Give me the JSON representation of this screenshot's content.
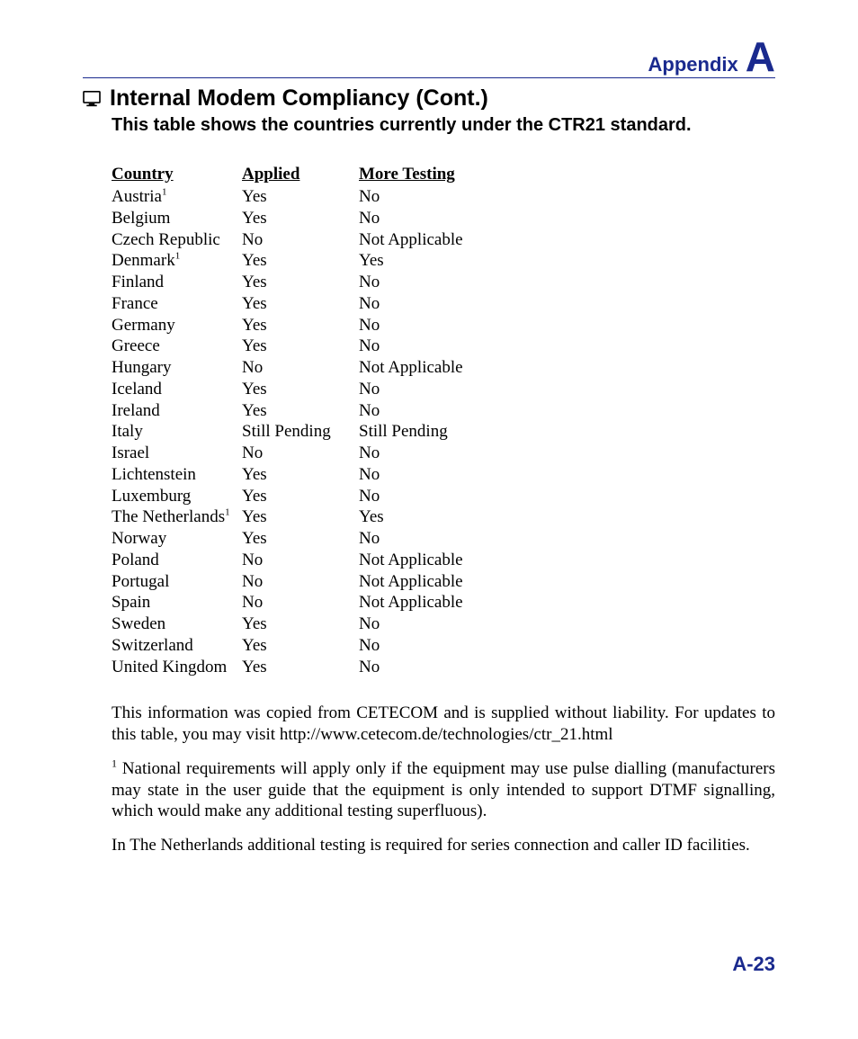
{
  "header": {
    "appendix_label": "Appendix",
    "appendix_letter": "A"
  },
  "title": "Internal Modem Compliancy (Cont.)",
  "subtitle": "This table shows the countries currently under the CTR21 standard.",
  "table": {
    "headers": {
      "country": "Country",
      "applied": "Applied",
      "more": "More Testing"
    },
    "rows": [
      {
        "country": "Austria",
        "sup": "1",
        "applied": "Yes",
        "more": "No"
      },
      {
        "country": "Belgium",
        "applied": "Yes",
        "more": "No"
      },
      {
        "country": "Czech Republic",
        "applied": "No",
        "more": "Not Applicable"
      },
      {
        "country": "Denmark",
        "sup": "1",
        "applied": "Yes",
        "more": "Yes"
      },
      {
        "country": "Finland",
        "applied": "Yes",
        "more": "No"
      },
      {
        "country": "France",
        "applied": "Yes",
        "more": "No"
      },
      {
        "country": "Germany",
        "applied": "Yes",
        "more": "No"
      },
      {
        "country": "Greece",
        "applied": "Yes",
        "more": "No"
      },
      {
        "country": "Hungary",
        "applied": "No",
        "more": "Not Applicable"
      },
      {
        "country": "Iceland",
        "applied": "Yes",
        "more": "No"
      },
      {
        "country": "Ireland",
        "applied": "Yes",
        "more": "No"
      },
      {
        "country": "Italy",
        "applied": "Still Pending",
        "more": "Still Pending"
      },
      {
        "country": "Israel",
        "applied": "No",
        "more": "No"
      },
      {
        "country": "Lichtenstein",
        "applied": "Yes",
        "more": "No"
      },
      {
        "country": "Luxemburg",
        "applied": "Yes",
        "more": "No"
      },
      {
        "country": "The Netherlands",
        "sup": "1",
        "applied": "Yes",
        "more": "Yes"
      },
      {
        "country": "Norway",
        "applied": "Yes",
        "more": "No"
      },
      {
        "country": "Poland",
        "applied": "No",
        "more": "Not Applicable"
      },
      {
        "country": "Portugal",
        "applied": "No",
        "more": "Not Applicable"
      },
      {
        "country": "Spain",
        "applied": "No",
        "more": "Not Applicable"
      },
      {
        "country": "Sweden",
        "applied": "Yes",
        "more": "No"
      },
      {
        "country": "Switzerland",
        "applied": "Yes",
        "more": "No"
      },
      {
        "country": "United Kingdom",
        "applied": "Yes",
        "more": "No"
      }
    ]
  },
  "paragraphs": {
    "p1": "This information was copied from CETECOM and is supplied without liability. For updates to this table, you may visit http://www.cetecom.de/technologies/ctr_21.html",
    "p2_num": "1",
    "p2": " National requirements will apply only if the equipment may use pulse dialling (manufacturers may state in the user guide that the equipment is only intended to support DTMF signalling, which would make any additional testing superfluous).",
    "p3": "In The Netherlands additional testing is required for series connection and caller ID facilities."
  },
  "page_number": "A-23"
}
